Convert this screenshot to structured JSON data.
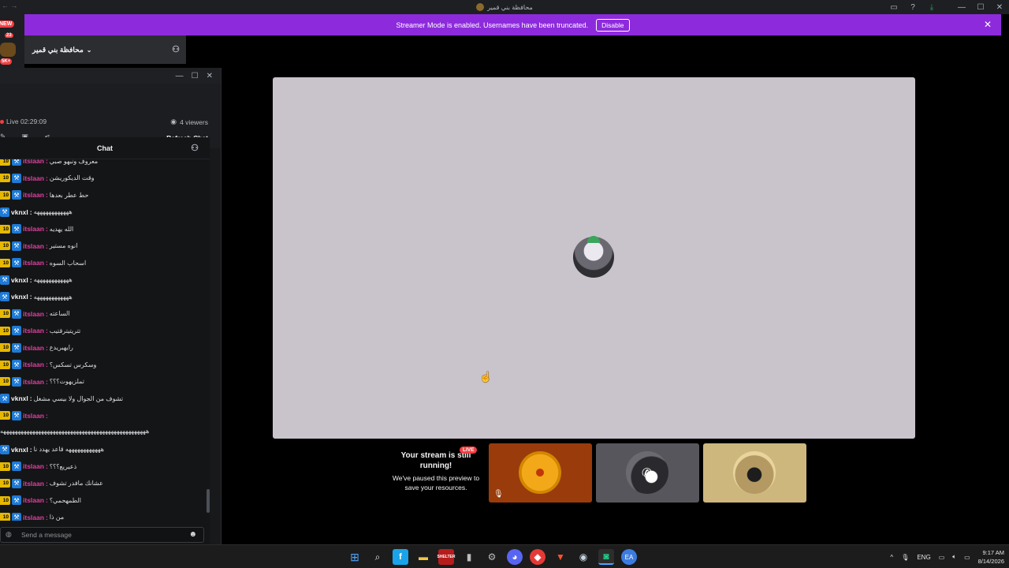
{
  "window": {
    "title": "محافظة بني قمير",
    "controls": {
      "minimize": "—",
      "maximize": "☐",
      "close": "✕"
    },
    "nav_arrows": "← →"
  },
  "server_strip": {
    "new_badge": "NEW",
    "mention_badge": "23",
    "count_badge": "5K+"
  },
  "banner": {
    "message": "Streamer Mode is enabled. Usernames have been truncated.",
    "disable_label": "Disable",
    "close": "✕",
    "color": "#8d2bdc"
  },
  "server_header": {
    "name": "محافظة بني قمير",
    "chevron": "⌄",
    "invite_icon": "person-add-icon"
  },
  "popout": {
    "controls": {
      "minimize": "—",
      "maximize": "☐",
      "close": "✕"
    },
    "live_time": "Live 02:29:09",
    "viewers": "4 viewers",
    "refresh_label": "Refresh Chat"
  },
  "chat": {
    "title": "Chat",
    "input_placeholder": "Send a message",
    "messages": [
      {
        "level": "10",
        "user": "itslaan",
        "color": "pink",
        "text": "معروف ونبهو صبي"
      },
      {
        "level": "10",
        "user": "itslaan",
        "color": "pink",
        "text": "وقت الديكوريشن"
      },
      {
        "level": "10",
        "user": "itslaan",
        "color": "pink",
        "text": "حط عطر بعدها"
      },
      {
        "level": "",
        "user": "vknxl",
        "color": "white",
        "text": "ههههههههههههه"
      },
      {
        "level": "10",
        "user": "itslaan",
        "color": "pink",
        "text": "الله يهديه"
      },
      {
        "level": "10",
        "user": "itslaan",
        "color": "pink",
        "text": "انوه مستير"
      },
      {
        "level": "10",
        "user": "itslaan",
        "color": "pink",
        "text": "اسحاب السوه"
      },
      {
        "level": "",
        "user": "vknxl",
        "color": "white",
        "text": "ههههههههههههه"
      },
      {
        "level": "",
        "user": "vknxl",
        "color": "white",
        "text": "ههههههههههههه"
      },
      {
        "level": "10",
        "user": "itslaan",
        "color": "pink",
        "text": "الساعته"
      },
      {
        "level": "10",
        "user": "itslaan",
        "color": "pink",
        "text": "تتريتيترقتيب"
      },
      {
        "level": "10",
        "user": "itslaan",
        "color": "pink",
        "text": "رايهبريدع"
      },
      {
        "level": "10",
        "user": "itslaan",
        "color": "pink",
        "text": "وسكرس تسكس؟"
      },
      {
        "level": "10",
        "user": "itslaan",
        "color": "pink",
        "text": "تملزيهوت؟؟؟"
      },
      {
        "level": "",
        "user": "vknxl",
        "color": "white",
        "text": "تشوف من الجوال ولا بيسي مشغل"
      },
      {
        "level": "10",
        "user": "itslaan",
        "color": "pink",
        "text": ""
      },
      {
        "level": "",
        "user": "",
        "color": "white",
        "text": "ههههههههههههههههههههههههههههههههههههههههههههههههههه"
      },
      {
        "level": "",
        "user": "vknxl",
        "color": "white",
        "text": "ههههههههههههه قاعد يهدد نا"
      },
      {
        "level": "10",
        "user": "itslaan",
        "color": "pink",
        "text": "ذعيريع؟؟؟"
      },
      {
        "level": "10",
        "user": "itslaan",
        "color": "pink",
        "text": "عشانك مافدر تشوف"
      },
      {
        "level": "10",
        "user": "itslaan",
        "color": "pink",
        "text": "الطمهحمي؟"
      },
      {
        "level": "10",
        "user": "itslaan",
        "color": "pink",
        "text": "من ذا"
      }
    ]
  },
  "preview": {
    "paused_title": "Your stream is still running!",
    "paused_sub": "We've paused this preview to save your resources.",
    "live_badge": "LIVE"
  },
  "taskbar": {
    "apps": [
      "windows-start",
      "search",
      "facebook",
      "file-explorer",
      "shelter",
      "usb",
      "settings",
      "discord",
      "app-red",
      "brave",
      "steam",
      "discord-active",
      "ea-app"
    ],
    "lang": "ENG",
    "time": "9:17 AM",
    "date": "8/14/2026",
    "tray_chevron": "^"
  }
}
